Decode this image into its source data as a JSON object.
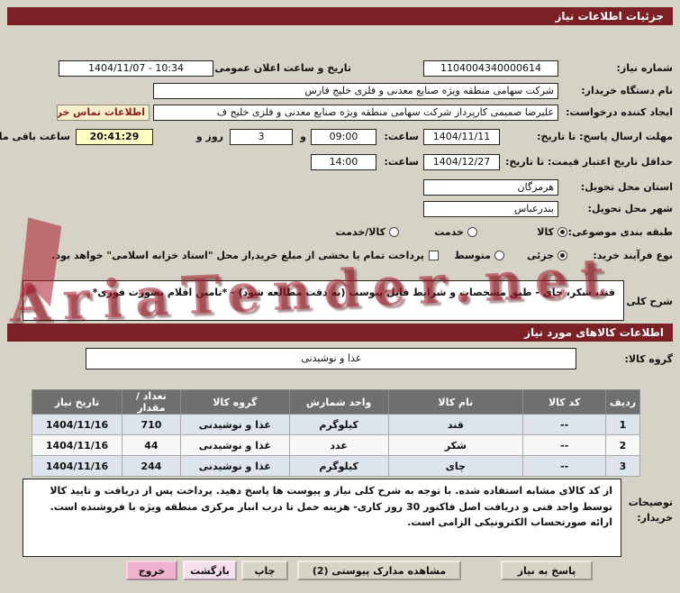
{
  "watermark": {
    "text": "AriaTender.net"
  },
  "title_bar": {
    "title": "جزئیات اطلاعات نیاز"
  },
  "form": {
    "need_number_label": "شماره نیاز:",
    "need_number": "1104004340000614",
    "announce_label": "تاریخ و ساعت اعلان عمومی:",
    "announce_value": "1404/11/07 - 10:34",
    "buyer_org_label": "نام دستگاه خریدار:",
    "buyer_org": "شرکت سهامی منطقه ویژه صنایع معدنی و فلزی خلیج فارس",
    "creator_label": "ایجاد کننده درخواست:",
    "creator": "علیرضا صمیمی کارپرداز شرکت سهامی منطقه ویژه صنایع معدنی و فلزی خلیج ف",
    "contact_button": "اطلاعات تماس خریدار",
    "deadline_label": "مهلت ارسال پاسخ: تا تاریخ:",
    "deadline_date": "1404/11/11",
    "deadline_hour_label": "ساعت:",
    "deadline_hour": "09:00",
    "and_label": "و",
    "days_value": "3",
    "days_label": "روز و",
    "countdown": "20:41:29",
    "remaining_label": "ساعت باقی مانده",
    "validity_label": "حداقل تاریخ اعتبار قیمت: تا تاریخ:",
    "validity_date": "1404/12/27",
    "validity_hour_label": "ساعت:",
    "validity_hour": "14:00",
    "province_label": "استان محل تحویل:",
    "province": "هرمزگان",
    "city_label": "شهر محل تحویل:",
    "city": "بندرعباس",
    "classification_label": "طبقه بندی موضوعی:",
    "classification_options": [
      "کالا",
      "خدمت",
      "کالا/خدمت"
    ],
    "classification_selected": "کالا",
    "process_label": "نوع فرآیند خرید:",
    "process_options": [
      "جزئی",
      "متوسط"
    ],
    "process_selected": "جزئی",
    "treasury_note": "پرداخت تمام یا بخشی از مبلغ خرید,از محل \"اسناد خزانه اسلامی\" خواهد بود."
  },
  "need_desc": {
    "label": "شرح کلی نیاز:",
    "text": "قند، شکر، چای - طبق مشخصات و شرایط فایل پیوست (به دقت مطالعه شود) - *تامین اقلام بصورت فوری*"
  },
  "goods_section": {
    "title": "اطلاعات کالاهای مورد نیاز",
    "group_label": "گروه کالا:",
    "group_value": "غذا و نوشیدنی"
  },
  "table": {
    "headers": [
      "ردیف",
      "کد کالا",
      "نام کالا",
      "واحد شمارش",
      "گروه کالا",
      "تعداد / مقدار",
      "تاریخ نیاز"
    ],
    "rows": [
      [
        "1",
        "--",
        "قند",
        "کیلوگرم",
        "غذا و نوشیدنی",
        "710",
        "1404/11/16"
      ],
      [
        "2",
        "--",
        "شکر",
        "عدد",
        "غذا و نوشیدنی",
        "44",
        "1404/11/16"
      ],
      [
        "3",
        "--",
        "چای",
        "کیلوگرم",
        "غذا و نوشیدنی",
        "244",
        "1404/11/16"
      ]
    ]
  },
  "notes": {
    "label": "توضیحات خریدار:",
    "text": "از کد کالای مشابه استفاده شده. با توجه به شرح کلی نیاز و پیوست ها پاسخ دهید. پرداخت پس از دریافت و تایید کالا توسط واحد فنی و دریافت اصل فاکتور 30 روز کاری- هزینه حمل تا درب انبار مرکزی منطقه ویژه با فروشنده است. ارائه صورتحساب الکترونیکی الزامی است."
  },
  "buttons": {
    "reply": "پاسخ به نیاز",
    "view_attachments": "مشاهده مدارک پیوستی (2)",
    "print": "چاپ",
    "back": "بازگشت",
    "exit": "خروج"
  },
  "colors": {
    "header_bar": "#7b2126",
    "highlight_yellow": "#ffffc4",
    "exit_pink": "#eeb2cf",
    "watermark_red": "#a51c2a"
  }
}
